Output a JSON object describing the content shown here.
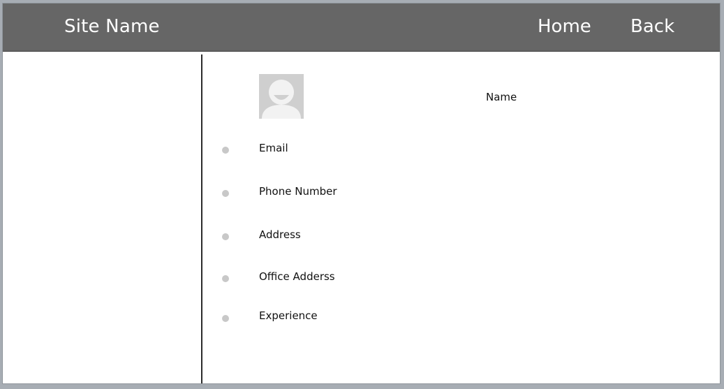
{
  "header": {
    "site_name": "Site Name",
    "nav": {
      "home": "Home",
      "back": "Back"
    }
  },
  "profile": {
    "name_label": "Name",
    "avatar_icon": "user-avatar-icon",
    "fields": [
      {
        "label": "Email"
      },
      {
        "label": "Phone Number"
      },
      {
        "label": "Address"
      },
      {
        "label": "Office Adderss"
      },
      {
        "label": "Experience"
      }
    ]
  },
  "colors": {
    "header_bg": "#666666",
    "header_text": "#ffffff",
    "bullet": "#c8c8c8",
    "avatar_bg": "#cfcfcf"
  }
}
